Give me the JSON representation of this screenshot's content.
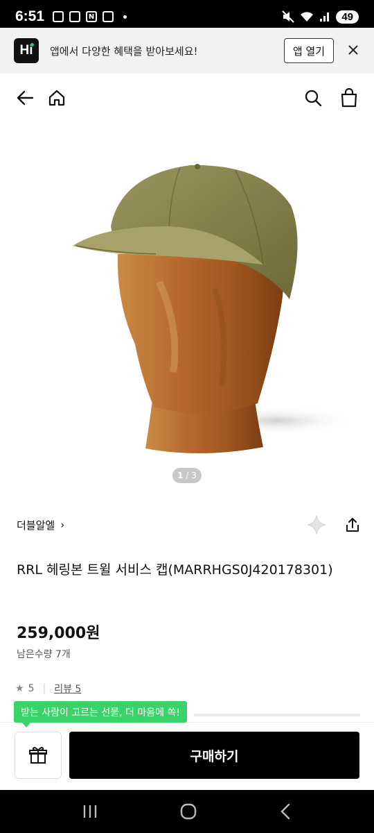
{
  "status_bar": {
    "time": "6:51",
    "icons": [
      "screenshot-icon",
      "gallery-icon",
      "naver-icon",
      "news-icon"
    ],
    "battery": "49"
  },
  "app_banner": {
    "logo": "Hi",
    "message": "앱에서 다양한 혜택을 받아보세요!",
    "open_button": "앱 열기",
    "close_icon": "close-icon"
  },
  "navbar": {
    "icons": [
      "back-arrow-icon",
      "home-icon",
      "search-icon",
      "shopping-bag-icon"
    ]
  },
  "image_pager": {
    "current": "1",
    "separator": " / ",
    "total": "3"
  },
  "product": {
    "brand": "더블알엘",
    "brand_chevron": "›",
    "title": "RRL 헤링본 트윌 서비스 캡(MARRHGS0J420178301)",
    "price": "259,000원",
    "stock": "남은수량 7개",
    "rating": "5",
    "review_label": "리뷰 5"
  },
  "colors": {
    "tooltip_bg": "#3ad36b",
    "buy_button_bg": "#000000",
    "cap_color": "#8a8550",
    "head_color": "#b8692c"
  },
  "tooltip": {
    "text": "받는 사람이 고르는 선물, 더 마음에 쏙!"
  },
  "bottom_bar": {
    "gift_icon": "gift-icon",
    "buy_label": "구매하기"
  },
  "system_nav": {
    "icons": [
      "recents-icon",
      "home-circle-icon",
      "back-chevron-icon"
    ]
  }
}
